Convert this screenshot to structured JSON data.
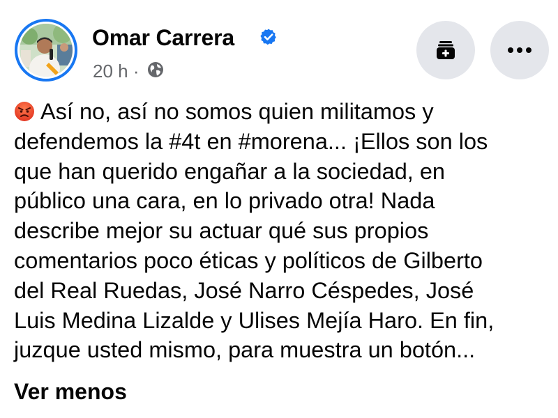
{
  "post": {
    "author_name": "Omar Carrera",
    "verified": true,
    "timestamp": "20 h",
    "separator": "·",
    "audience_icon": "globe-icon",
    "emoji_icon": "angry-face-emoji",
    "body_lines": [
      "Así no, así no somos quien militamos y",
      "defendemos la #4t en #morena... ¡Ellos son los",
      "que han querido engañar a la sociedad, en",
      "público una cara, en lo privado otra! Nada",
      "describe mejor su actuar qué sus propios",
      "comentarios poco éticas y políticos de Gilberto",
      "del Real Ruedas, José Narro Céspedes, José",
      "Luis Medina Lizalde y Ulises Mejía Haro. En fin,",
      "juzque usted mismo, para muestra un botón..."
    ],
    "see_less_label": "Ver menos"
  },
  "actions": {
    "collection_icon": "add-to-collection-icon",
    "more_icon": "more-options-icon"
  },
  "colors": {
    "accent_blue": "#1877f2",
    "secondary_text": "#65676b",
    "button_bg": "#e4e6eb",
    "primary_text": "#050505"
  }
}
